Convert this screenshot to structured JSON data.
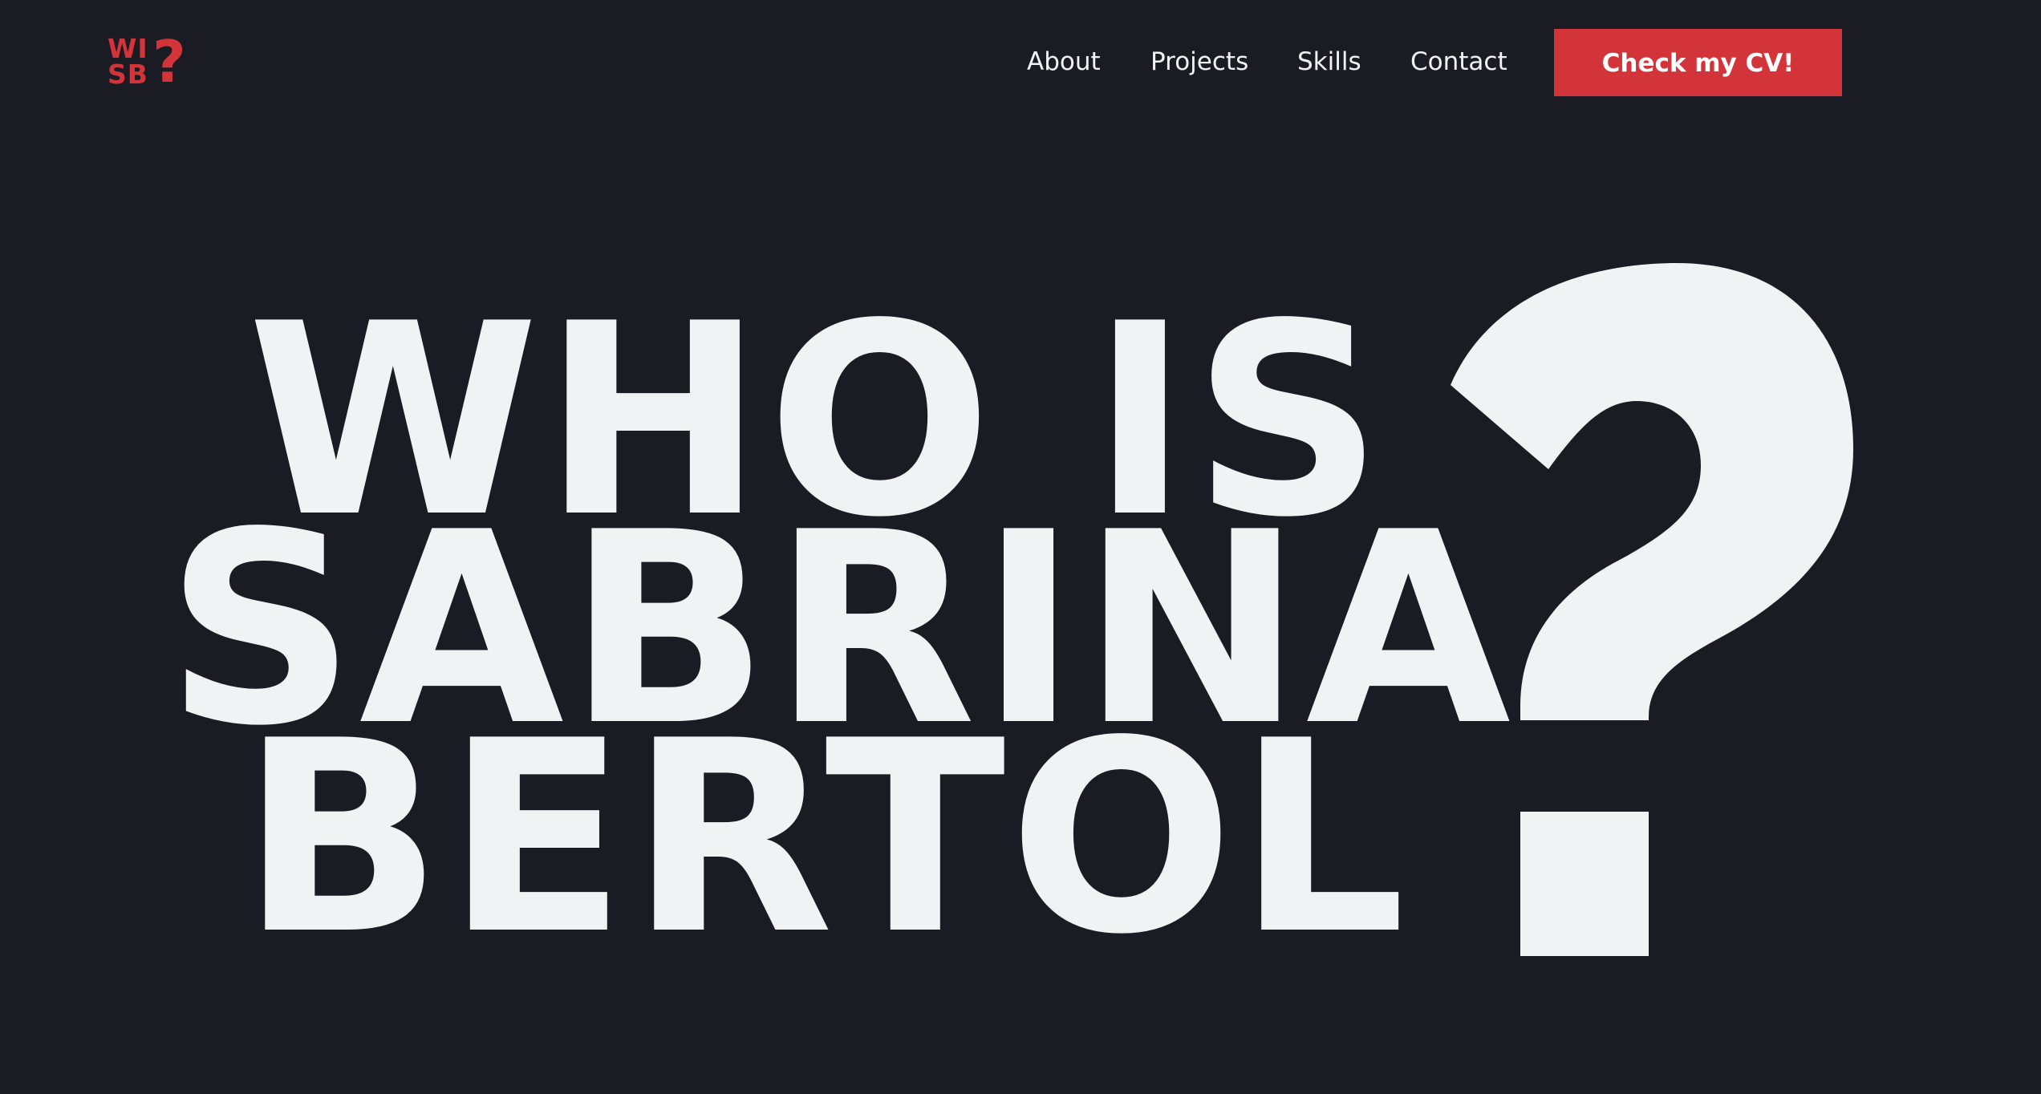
{
  "logo": {
    "row1": "WI",
    "row2": "SB",
    "mark": "?"
  },
  "nav": {
    "items": [
      {
        "label": "About"
      },
      {
        "label": "Projects"
      },
      {
        "label": "Skills"
      },
      {
        "label": "Contact"
      }
    ],
    "cta_label": "Check my CV!"
  },
  "hero": {
    "line1": "WHO IS",
    "line2": "SABRINA",
    "line3": "BERTOL"
  },
  "colors": {
    "background": "#1b1b24",
    "accent": "#d3343a",
    "text": "#f1f2f4"
  }
}
